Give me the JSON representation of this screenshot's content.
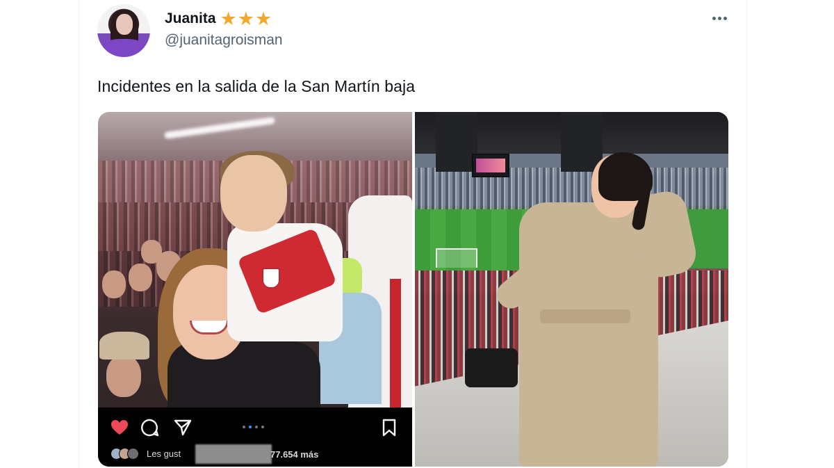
{
  "tweet": {
    "author": {
      "display_name": "Juanita",
      "handle": "@juanitagroisman",
      "badges": [
        "★",
        "★",
        "★"
      ],
      "badge_color": "#f4a82b"
    },
    "text": "Incidentes en la salida de la San Martín baja",
    "more_icon": "more-horizontal-icon"
  },
  "media": {
    "left_photo": {
      "instagram_bar": {
        "icons": [
          "heart-icon",
          "comment-icon",
          "share-icon",
          "bookmark-icon"
        ],
        "heart_color": "#ed4956",
        "carousel_dots": 4,
        "carousel_active": 1,
        "likes_prefix": "Les gust",
        "likes_suffix": "77.654 más"
      }
    }
  },
  "colors": {
    "text_primary": "#0f1419",
    "text_secondary": "#536471",
    "instagram_bar_bg": "#000000"
  }
}
